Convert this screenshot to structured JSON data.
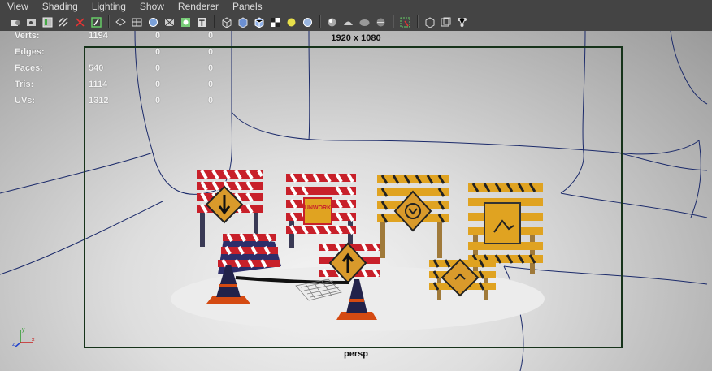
{
  "menu": [
    "View",
    "Shading",
    "Lighting",
    "Show",
    "Renderer",
    "Panels"
  ],
  "toolbar_icons": [
    "camera-attributes-icon",
    "bookmark-camera-icon",
    "image-plane-icon",
    "grid-toggle-icon",
    "snapshot-icon",
    "film-gate-icon",
    "separator",
    "wireframe-icon",
    "smooth-shade-icon",
    "shade-all-icon",
    "xray-icon",
    "texture-icon",
    "text-icon",
    "separator",
    "wireframe-cube-icon",
    "shaded-cube-icon",
    "wire-on-shaded-icon",
    "checker-texture-icon",
    "default-light-icon",
    "all-lights-icon",
    "separator",
    "shadows-icon",
    "screen-ao-icon",
    "motion-blur-icon",
    "anti-alias-icon",
    "separator",
    "isolate-select-icon",
    "separator",
    "xray-active-icon",
    "xray-joints-icon",
    "hypershade-icon"
  ],
  "hud": {
    "rows": [
      {
        "label": "Verts:",
        "a": "1194",
        "b": "0",
        "c": "0"
      },
      {
        "label": "Edges:",
        "a": "",
        "b": "0",
        "c": "0"
      },
      {
        "label": "Faces:",
        "a": "540",
        "b": "0",
        "c": "0"
      },
      {
        "label": "Tris:",
        "a": "1114",
        "b": "0",
        "c": "0"
      },
      {
        "label": "UVs:",
        "a": "1312",
        "b": "0",
        "c": "0"
      }
    ]
  },
  "resolution": "1920 x 1080",
  "camera": "persp",
  "signs": {
    "work_text": "UNWORK"
  },
  "colors": {
    "gate": "#16331a",
    "wire": "#1b2a6a",
    "red": "#c8202a",
    "yellow": "#e0a321"
  }
}
